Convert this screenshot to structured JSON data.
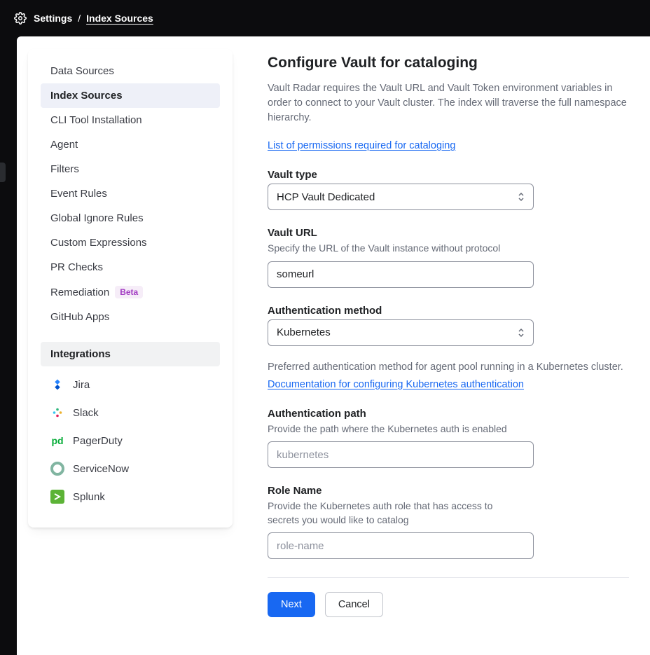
{
  "breadcrumb": {
    "parent": "Settings",
    "current": "Index Sources"
  },
  "sidebar": {
    "items": [
      {
        "label": "Data Sources"
      },
      {
        "label": "Index Sources"
      },
      {
        "label": "CLI Tool Installation"
      },
      {
        "label": "Agent"
      },
      {
        "label": "Filters"
      },
      {
        "label": "Event Rules"
      },
      {
        "label": "Global Ignore Rules"
      },
      {
        "label": "Custom Expressions"
      },
      {
        "label": "PR Checks"
      },
      {
        "label": "Remediation",
        "badge": "Beta"
      },
      {
        "label": "GitHub Apps"
      }
    ],
    "integrations_header": "Integrations",
    "integrations": [
      {
        "label": "Jira"
      },
      {
        "label": "Slack"
      },
      {
        "label": "PagerDuty"
      },
      {
        "label": "ServiceNow"
      },
      {
        "label": "Splunk"
      }
    ]
  },
  "page": {
    "title": "Configure Vault for cataloging",
    "intro": "Vault Radar requires the Vault URL and Vault Token environment variables in order to connect to your Vault cluster. The index will traverse the full namespace hierarchy.",
    "permissions_link": "List of permissions required for cataloging",
    "vault_type": {
      "label": "Vault type",
      "value": "HCP Vault Dedicated"
    },
    "vault_url": {
      "label": "Vault URL",
      "help": "Specify the URL of the Vault instance without protocol",
      "value": "someurl"
    },
    "auth_method": {
      "label": "Authentication method",
      "value": "Kubernetes"
    },
    "auth_note": "Preferred authentication method for agent pool running in a Kubernetes cluster.",
    "auth_doc_link": "Documentation for configuring Kubernetes authentication",
    "auth_path": {
      "label": "Authentication path",
      "help": "Provide the path where the Kubernetes auth is enabled",
      "placeholder": "kubernetes"
    },
    "role_name": {
      "label": "Role Name",
      "help": "Provide the Kubernetes auth role that has access to secrets you would like to catalog",
      "placeholder": "role-name"
    },
    "buttons": {
      "next": "Next",
      "cancel": "Cancel"
    }
  }
}
